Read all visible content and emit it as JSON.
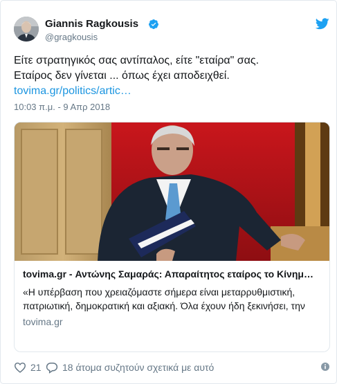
{
  "author": {
    "name": "Giannis Ragkousis",
    "handle": "@gragkousis",
    "verified": true
  },
  "tweet": {
    "line1": "Είτε στρατηγικός σας αντίπαλος, είτε \"εταίρα\" σας.",
    "line2": "Εταίρος δεν γίνεται ... όπως έχει αποδειχθεί.",
    "link": "tovima.gr/politics/artic…",
    "timestamp": "10:03 π.μ. - 9 Απρ 2018"
  },
  "card": {
    "title": "tovima.gr - Αντώνης Σαμαράς: Απαραίτητος εταίρος το Κίνημ…",
    "description": "«Η υπέρβαση που χρειαζόμαστε σήμερα είναι μεταρρυθμιστική, πατριωτική, δημοκρατική και αξιακή. Όλα έχουν ήδη ξεκινήσει, την",
    "domain": "tovima.gr"
  },
  "actions": {
    "like_count": "21",
    "reply_text": "18 άτομα συζητούν σχετικά με αυτό"
  },
  "colors": {
    "accent": "#1da1f2",
    "link": "#1b95e0",
    "secondary_text": "#657786",
    "border": "#e1e8ed"
  },
  "icons": [
    "verified-badge-icon",
    "twitter-logo-icon",
    "heart-icon",
    "reply-bubble-icon",
    "info-icon"
  ]
}
